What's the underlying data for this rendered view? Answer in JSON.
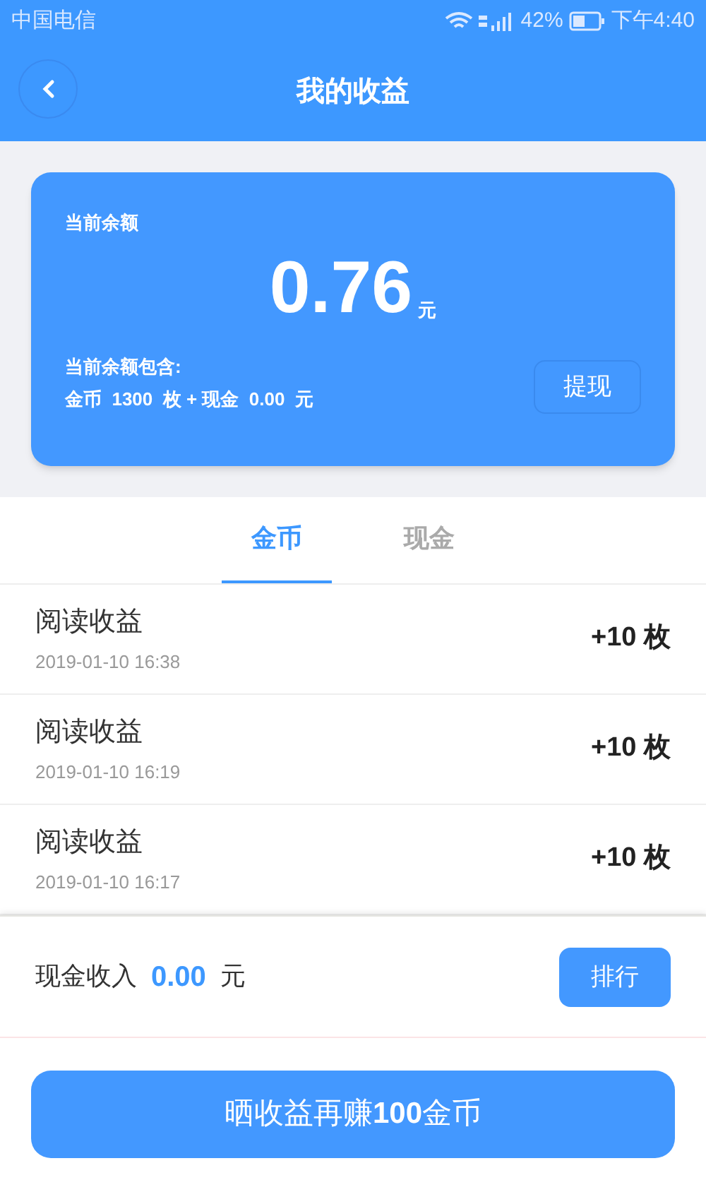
{
  "status_bar": {
    "carrier": "中国电信",
    "battery": "42%",
    "time": "下午4:40"
  },
  "header": {
    "title": "我的收益"
  },
  "balance_card": {
    "label": "当前余额",
    "amount": "0.76",
    "unit": "元",
    "breakdown_label": "当前余额包含:",
    "breakdown": "金币  1300  枚 + 现金  0.00  元",
    "withdraw_button": "提现"
  },
  "tabs": [
    {
      "label": "金币",
      "selected": true
    },
    {
      "label": "现金",
      "selected": false
    }
  ],
  "records": [
    {
      "title": "阅读收益",
      "time": "2019-01-10 16:38",
      "amount": "+10 枚"
    },
    {
      "title": "阅读收益",
      "time": "2019-01-10 16:19",
      "amount": "+10 枚"
    },
    {
      "title": "阅读收益",
      "time": "2019-01-10 16:17",
      "amount": "+10 枚"
    }
  ],
  "cash_income": {
    "label": "现金收入",
    "value": "0.00",
    "unit": "元",
    "rank_button": "排行"
  },
  "share_button": "晒收益再赚**100**金币"
}
